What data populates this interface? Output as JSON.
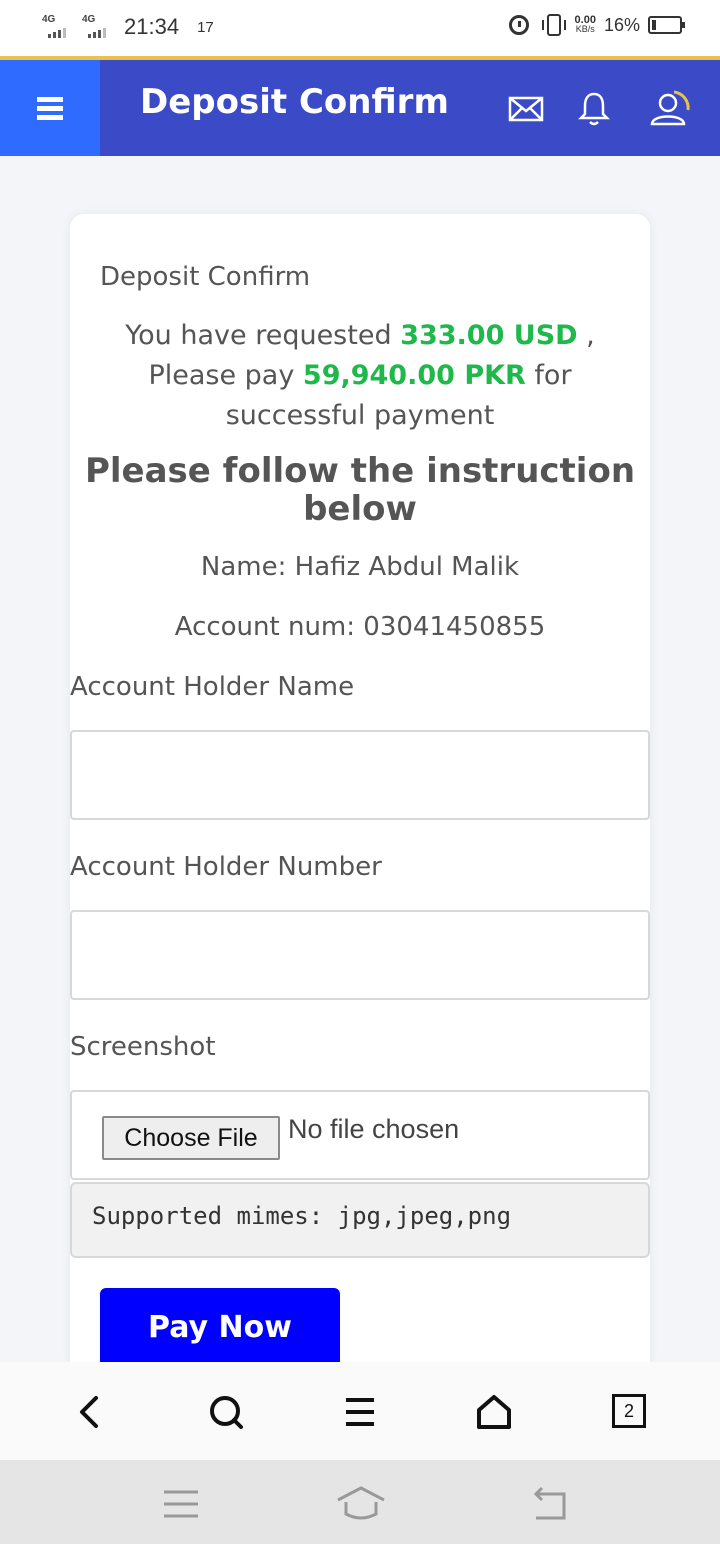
{
  "status_bar": {
    "network_1": "4G",
    "network_2": "4G",
    "time": "21:34",
    "notification_count": "17",
    "speed_value": "0.00",
    "speed_unit": "KB/s",
    "battery_percent": "16%",
    "battery_level": 0.16
  },
  "header": {
    "title": "Deposit Confirm",
    "icons": [
      "menu-icon",
      "mail-icon",
      "bell-icon",
      "user-icon"
    ],
    "menu_color": "#2f6bff",
    "bar_color": "#3b4bc8"
  },
  "card": {
    "title": "Deposit Confirm",
    "request_prefix": "You have requested",
    "request_amount": "333.00 USD",
    "request_comma": ",",
    "pay_prefix": "Please pay",
    "pay_amount": "59,940.00 PKR",
    "pay_suffix": "for",
    "pay_tail": "successful payment",
    "instruction": "Please follow the instruction below",
    "name_line": "Name: Hafiz Abdul Malik",
    "account_line": "Account num: 03041450855",
    "highlight_color": "#1fb84a"
  },
  "form": {
    "holder_name_label": "Account Holder Name",
    "holder_name_value": "",
    "holder_number_label": "Account Holder Number",
    "holder_number_value": "",
    "screenshot_label": "Screenshot",
    "choose_file_label": "Choose File",
    "file_status": "No file chosen",
    "mimes_note": "Supported mimes: jpg,jpeg,png",
    "submit_label": "Pay Now",
    "submit_color": "#0000ff"
  },
  "browser_bar": {
    "icons": [
      "back-icon",
      "search-icon",
      "menu-icon",
      "home-icon",
      "tabs-icon"
    ],
    "tabs_count": "2"
  },
  "system_nav": {
    "icons": [
      "recent-apps-icon",
      "home-icon",
      "return-icon"
    ]
  }
}
